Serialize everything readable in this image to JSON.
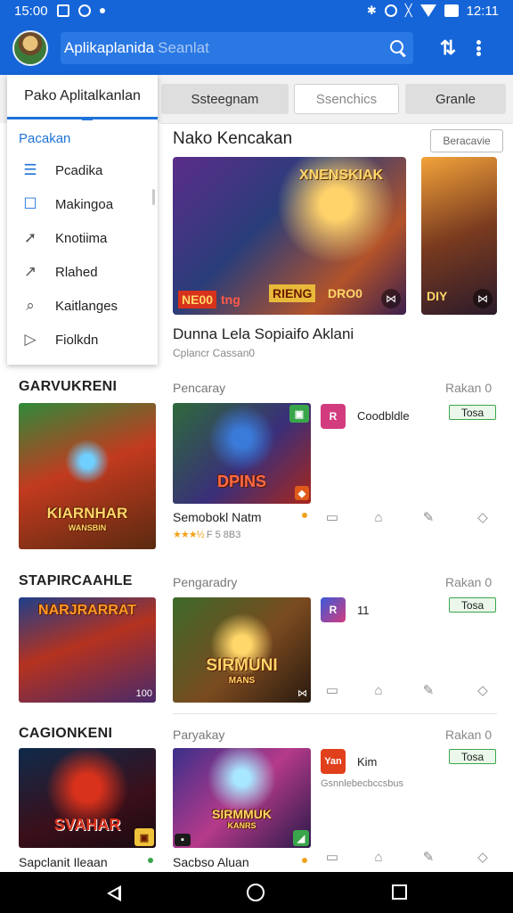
{
  "status": {
    "time": "15:00",
    "clock": "12:11"
  },
  "app_bar": {
    "title": "Aplikaplanida",
    "search_placeholder": "Seanlat"
  },
  "tabs": {
    "t2": "Ssteegnam",
    "t3": "Ssenchics",
    "t4": "Granle"
  },
  "drawer": {
    "tab_label": "Pako Aplitalkanlan",
    "heading": "Pacakan",
    "items": [
      {
        "label": "Pcadika",
        "icon": "menu-icon"
      },
      {
        "label": "Makingoa",
        "icon": "square-icon"
      },
      {
        "label": "Knotiima",
        "icon": "share-arrow-icon"
      },
      {
        "label": "Rlahed",
        "icon": "trend-arrow-icon"
      },
      {
        "label": "Kaitlanges",
        "icon": "search-icon"
      },
      {
        "label": "Fiolkdn",
        "icon": "play-tag-icon"
      }
    ]
  },
  "featured": {
    "title": "Nako Kencakan",
    "button": "Beracavie",
    "hero_banner": "XNENSKIAK",
    "hero_tags": [
      "NE00",
      "tng",
      "RIENG",
      "DRO0"
    ],
    "hero2_tag": "DIY",
    "name": "Dunna Lela  Sopiaifo Aklani",
    "sub": "Cplancr Cassan0"
  },
  "sections": [
    {
      "title": "GARVUKRENI",
      "category": "Pencaray",
      "rank": "Rakan 0",
      "big_thumb_text": "KIARNHAR",
      "big_thumb_sub": "WANSBIN",
      "mid_thumb_text": "DPINS",
      "app_icon_letter": "R",
      "app_name": "Coodbldle",
      "install": "Tosa",
      "game_name": "Semobokl Natm",
      "rating_stars": "★★★½",
      "rating_text": "F 5 8B3"
    },
    {
      "title": "STAPIRCAAHLE",
      "category": "Pengaradry",
      "rank": "Rakan 0",
      "big_thumb_text": "NARJRARRAT",
      "big_thumb_corner": "100",
      "mid_thumb_text": "SIRMUNI",
      "mid_thumb_sub": "MANS",
      "app_icon_letter": "R",
      "app_name": "11",
      "install": "Tosa"
    },
    {
      "title": "CAGIONKENI",
      "category": "Paryakay",
      "rank": "Rakan 0",
      "big_thumb_text": "SVAHAR",
      "mid_thumb_text": "SIRMMUK",
      "mid_thumb_sub": "KANRS",
      "app_icon_letter": "Yan",
      "app_name": "Kim",
      "app_desc": "Gsnnlebecbccsbus",
      "install": "Tosa",
      "big_name": "Sapclanit Ileaan",
      "game_name": "Sacbso Aluan"
    }
  ],
  "colors": {
    "primary": "#1565d8",
    "accent": "#1f73d9",
    "install_border": "#3aa64b"
  }
}
